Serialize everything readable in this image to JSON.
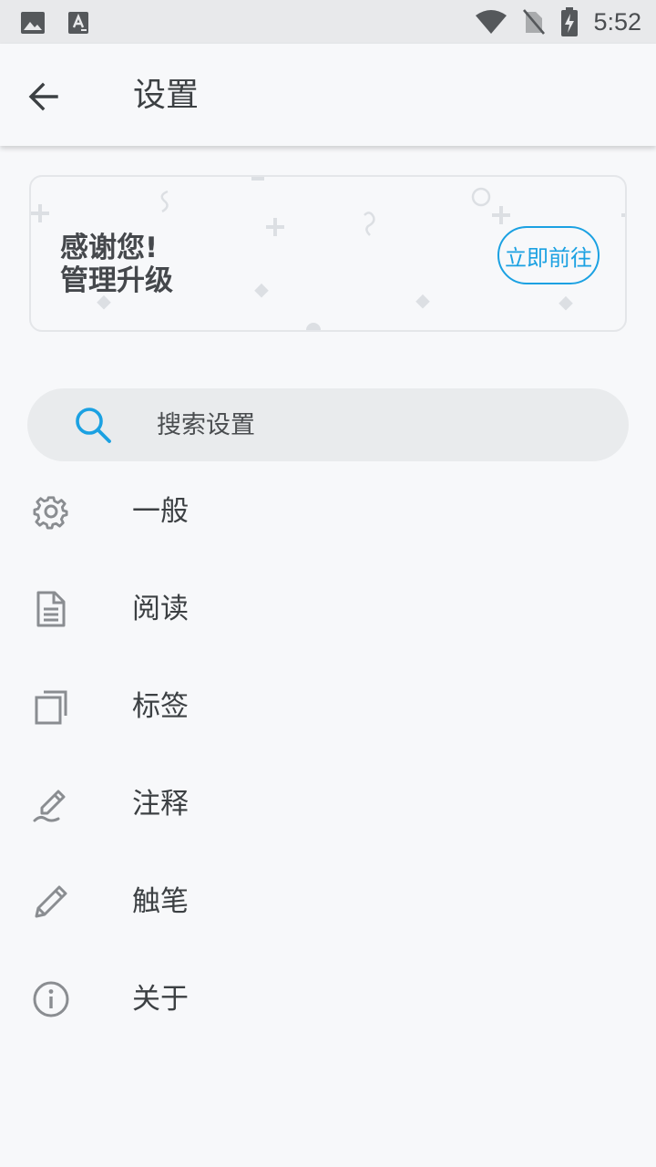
{
  "status_bar": {
    "time": "5:52",
    "icons": [
      "image-icon",
      "text-a-icon",
      "wifi-icon",
      "no-sim-icon",
      "battery-charging-icon"
    ]
  },
  "app_bar": {
    "title": "设置",
    "back_icon": "arrow-left-icon"
  },
  "promo": {
    "line1": "感谢您!",
    "line2": "管理升级",
    "button_label": "立即前往",
    "accent_color": "#1ba1e2"
  },
  "search": {
    "placeholder": "搜索设置",
    "icon": "search-icon"
  },
  "menu": {
    "items": [
      {
        "label": "一般",
        "icon": "gear-icon"
      },
      {
        "label": "阅读",
        "icon": "document-icon"
      },
      {
        "label": "标签",
        "icon": "tabs-icon"
      },
      {
        "label": "注释",
        "icon": "annotate-pen-icon"
      },
      {
        "label": "触笔",
        "icon": "pencil-icon"
      },
      {
        "label": "关于",
        "icon": "info-icon"
      }
    ]
  }
}
